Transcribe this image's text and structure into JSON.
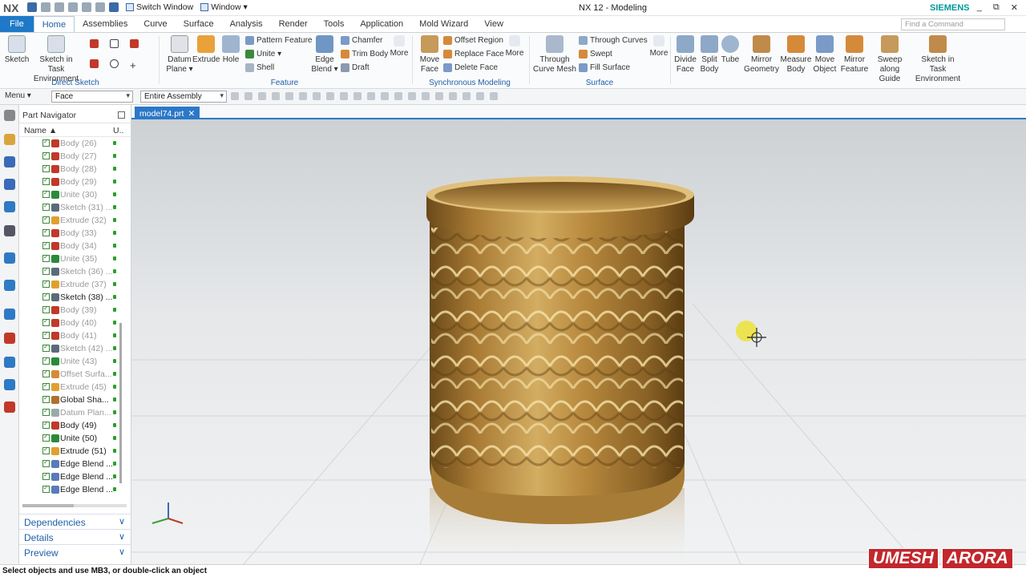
{
  "app": {
    "logo": "NX",
    "title": "NX 12 - Modeling",
    "brand": "SIEMENS"
  },
  "quick_access": {
    "switch_window": "Switch Window",
    "window": "Window ▾"
  },
  "window_controls": [
    "_",
    "⧉",
    "✕"
  ],
  "menu": {
    "file": "File",
    "tabs": [
      "Home",
      "Assemblies",
      "Curve",
      "Surface",
      "Analysis",
      "Render",
      "Tools",
      "Application",
      "Mold Wizard",
      "View"
    ]
  },
  "search": {
    "placeholder": "Find a Command"
  },
  "ribbon": {
    "direct_sketch": {
      "label": "Direct Sketch",
      "sketch": "Sketch",
      "sketch_task": "Sketch in Task Environment"
    },
    "feature": {
      "label": "Feature",
      "datum_plane": "Datum Plane ▾",
      "extrude": "Extrude",
      "hole": "Hole",
      "pattern_feature": "Pattern Feature",
      "unite": "Unite ▾",
      "shell": "Shell",
      "edge_blend": "Edge Blend ▾",
      "chamfer": "Chamfer",
      "trim_body": "Trim Body",
      "draft": "Draft",
      "more": "More"
    },
    "sync": {
      "label": "Synchronous Modeling",
      "move_face": "Move Face",
      "offset_region": "Offset Region",
      "replace_face": "Replace Face",
      "delete_face": "Delete Face",
      "more": "More"
    },
    "surface": {
      "label": "Surface",
      "through_curve_mesh": "Through Curve Mesh",
      "through_curves": "Through Curves",
      "swept": "Swept",
      "fill_surface": "Fill Surface",
      "more": "More"
    },
    "other": {
      "divide_face": "Divide Face",
      "split_body": "Split Body",
      "tube": "Tube",
      "mirror_geometry": "Mirror Geometry",
      "measure_body": "Measure Body",
      "move_object": "Move Object",
      "mirror_feature": "Mirror Feature",
      "sweep_guide": "Sweep along Guide",
      "sketch_task_env": "Sketch in Task Environment"
    }
  },
  "selection_bar": {
    "menu": "Menu ▾",
    "filter": "Face",
    "scope": "Entire Assembly"
  },
  "navigator": {
    "title": "Part Navigator",
    "col_name": "Name ▲",
    "col_u": "U..",
    "items": [
      {
        "label": "Body (26)",
        "type": "body",
        "dim": true
      },
      {
        "label": "Body (27)",
        "type": "body",
        "dim": true
      },
      {
        "label": "Body (28)",
        "type": "body",
        "dim": true
      },
      {
        "label": "Body (29)",
        "type": "body",
        "dim": true
      },
      {
        "label": "Unite (30)",
        "type": "unite",
        "dim": true
      },
      {
        "label": "Sketch (31) ...",
        "type": "sketch",
        "dim": true
      },
      {
        "label": "Extrude (32)",
        "type": "extrude",
        "dim": true
      },
      {
        "label": "Body (33)",
        "type": "body",
        "dim": true
      },
      {
        "label": "Body (34)",
        "type": "body",
        "dim": true
      },
      {
        "label": "Unite (35)",
        "type": "unite",
        "dim": true
      },
      {
        "label": "Sketch (36) ...",
        "type": "sketch",
        "dim": true
      },
      {
        "label": "Extrude (37)",
        "type": "extrude",
        "dim": true
      },
      {
        "label": "Sketch (38) ...",
        "type": "sketch",
        "dim": false
      },
      {
        "label": "Body (39)",
        "type": "body",
        "dim": true
      },
      {
        "label": "Body (40)",
        "type": "body",
        "dim": true
      },
      {
        "label": "Body (41)",
        "type": "body",
        "dim": true
      },
      {
        "label": "Sketch (42) ...",
        "type": "sketch",
        "dim": true
      },
      {
        "label": "Unite (43)",
        "type": "unite",
        "dim": true
      },
      {
        "label": "Offset Surfa...",
        "type": "offset",
        "dim": true
      },
      {
        "label": "Extrude (45)",
        "type": "extrude",
        "dim": true
      },
      {
        "label": "Global Sha...",
        "type": "global",
        "dim": false
      },
      {
        "label": "Datum Plan...",
        "type": "datum",
        "dim": true
      },
      {
        "label": "Body (49)",
        "type": "body",
        "dim": false
      },
      {
        "label": "Unite (50)",
        "type": "unite",
        "dim": false
      },
      {
        "label": "Extrude (51)",
        "type": "extrude",
        "dim": false
      },
      {
        "label": "Edge Blend ...",
        "type": "blend",
        "dim": false
      },
      {
        "label": "Edge Blend ...",
        "type": "blend",
        "dim": false
      },
      {
        "label": "Edge Blend ...",
        "type": "blend",
        "dim": false
      }
    ],
    "panels": [
      "Dependencies",
      "Details",
      "Preview"
    ]
  },
  "file_tab": {
    "name": "model74.prt",
    "close": "✕"
  },
  "status": "Select objects and use MB3, or double-click an object",
  "watermark": {
    "first": "UMESH",
    "second": "ARORA"
  },
  "colors": {
    "accent": "#2b78c8",
    "gold": "#b8893e",
    "brand": "#009999"
  }
}
